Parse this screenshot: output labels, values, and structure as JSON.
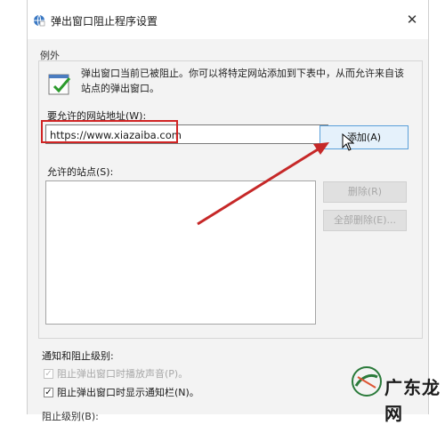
{
  "window": {
    "title": "弹出窗口阻止程序设置"
  },
  "exceptions": {
    "group_label": "例外",
    "description": "弹出窗口当前已被阻止。你可以将特定网站添加到下表中，从而允许来自该站点的弹出窗口。",
    "address_label": "要允许的网站地址(W):",
    "address_value": "https://www.xiazaiba.com",
    "add_button": "添加(A)",
    "allowed_sites_label": "允许的站点(S):",
    "allowed_sites": [],
    "remove_button": "删除(R)",
    "remove_all_button": "全部删除(E)..."
  },
  "notifications": {
    "group_label": "通知和阻止级别:",
    "play_sound_label": "阻止弹出窗口时播放声音(P)。",
    "play_sound_checked": true,
    "play_sound_enabled": false,
    "show_bar_label": "阻止弹出窗口时显示通知栏(N)。",
    "show_bar_checked": true,
    "block_level_label": "阻止级别(B):"
  },
  "watermark": {
    "text": "广东龙网"
  },
  "colors": {
    "highlight": "#d02424",
    "accent_button": "#e5f1fb"
  }
}
